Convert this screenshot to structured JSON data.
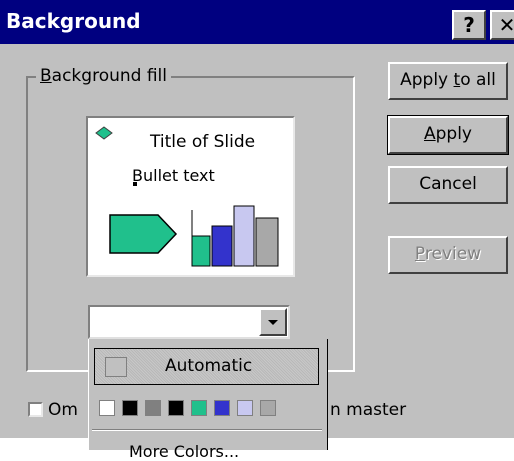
{
  "window": {
    "title": "Background",
    "help_button": "?",
    "close_button": "✕"
  },
  "group": {
    "label": "Background fill"
  },
  "preview": {
    "slide_title": "Title of Slide",
    "bullet_text": "Bullet text"
  },
  "buttons": {
    "apply_to_all": "Apply to all",
    "apply": "Apply",
    "cancel": "Cancel",
    "preview": "Preview"
  },
  "fill_dropdown": {
    "automatic_label": "Automatic",
    "swatches": [
      "#ffffff",
      "#000000",
      "#808080",
      "#000000",
      "#20c08c",
      "#3333cc",
      "#c8c8f0",
      "#a8a8a8"
    ],
    "more_label": "More Colors..."
  },
  "checkbox": {
    "label_visible_left": "Om",
    "label_visible_right": "n master",
    "checked": false
  },
  "colors": {
    "titlebar": "#000080",
    "dialog": "#c0c0c0",
    "diamond": "#20c08c"
  }
}
